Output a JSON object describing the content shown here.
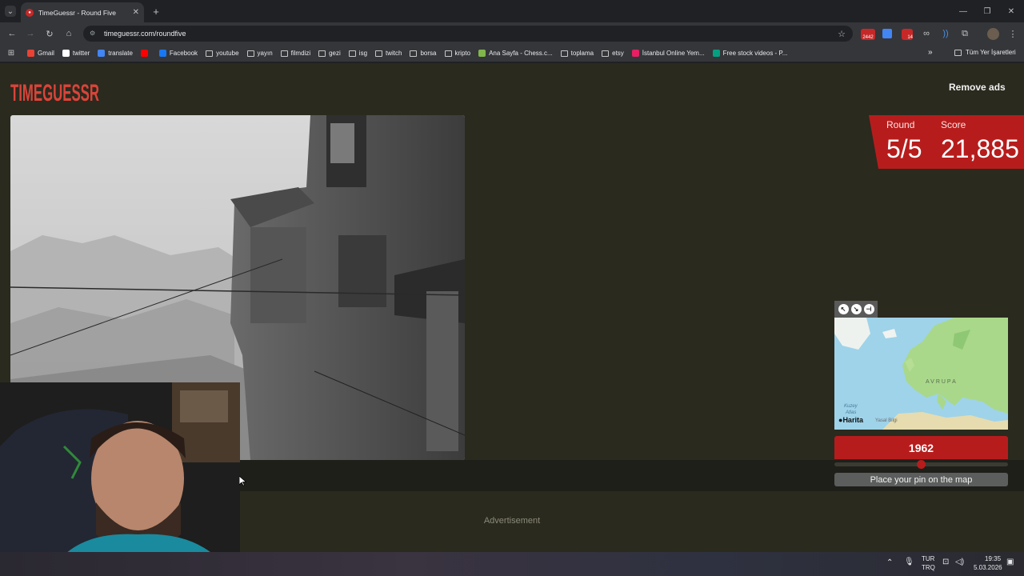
{
  "browser": {
    "tab_title": "TimeGuessr - Round Five",
    "url": "timeguessr.com/roundfive",
    "new_tab": "+",
    "window_controls": [
      "—",
      "❐",
      "✕"
    ]
  },
  "bookmarks": [
    {
      "label": "Gmail",
      "color": "#ea4335"
    },
    {
      "label": "twitter",
      "color": "#ffffff"
    },
    {
      "label": "translate",
      "color": "#4285f4"
    },
    {
      "label": "",
      "color": "#ff0000"
    },
    {
      "label": "Facebook",
      "color": "#1877f2"
    },
    {
      "label": "youtube",
      "folder": true
    },
    {
      "label": "yayın",
      "folder": true
    },
    {
      "label": "filmdizi",
      "folder": true
    },
    {
      "label": "gezi",
      "folder": true
    },
    {
      "label": "isg",
      "folder": true
    },
    {
      "label": "twitch",
      "folder": true
    },
    {
      "label": "borsa",
      "folder": true
    },
    {
      "label": "kripto",
      "folder": true
    },
    {
      "label": "Ana Sayfa - Chess.c...",
      "color": "#81b64c"
    },
    {
      "label": "toplama",
      "folder": true
    },
    {
      "label": "etsy",
      "folder": true
    },
    {
      "label": "İstanbul Online Yem...",
      "color": "#e91e63"
    },
    {
      "label": "Free stock videos - P...",
      "color": "#05a081"
    }
  ],
  "bookmarks_more": "»",
  "bookmarks_all": "Tüm Yer İşaretleri",
  "extensions": {
    "badge1": "2442",
    "badge2": "14"
  },
  "site": {
    "logo": "TIMEGUESSR",
    "remove_ads": "Remove ads",
    "advertisement": "Advertisement"
  },
  "score": {
    "round_label": "Round",
    "round_value": "5/5",
    "score_label": "Score",
    "score_value": "21,885"
  },
  "map": {
    "region_label": "AVRUPA",
    "sea_label_1": "Kuzey",
    "sea_label_2": "Atlas",
    "brand": "Harita",
    "legal": "Yasal Bilgi"
  },
  "year": {
    "value": "1962",
    "slider_fraction": 0.5
  },
  "pin_prompt": "Place your pin on the map",
  "taskbar": {
    "lang_1": "TUR",
    "lang_2": "TRQ",
    "time": "19:35",
    "date": "5.03.2026"
  },
  "colors": {
    "accent_red": "#b71c1c",
    "page_bg": "#2a2a1e"
  }
}
